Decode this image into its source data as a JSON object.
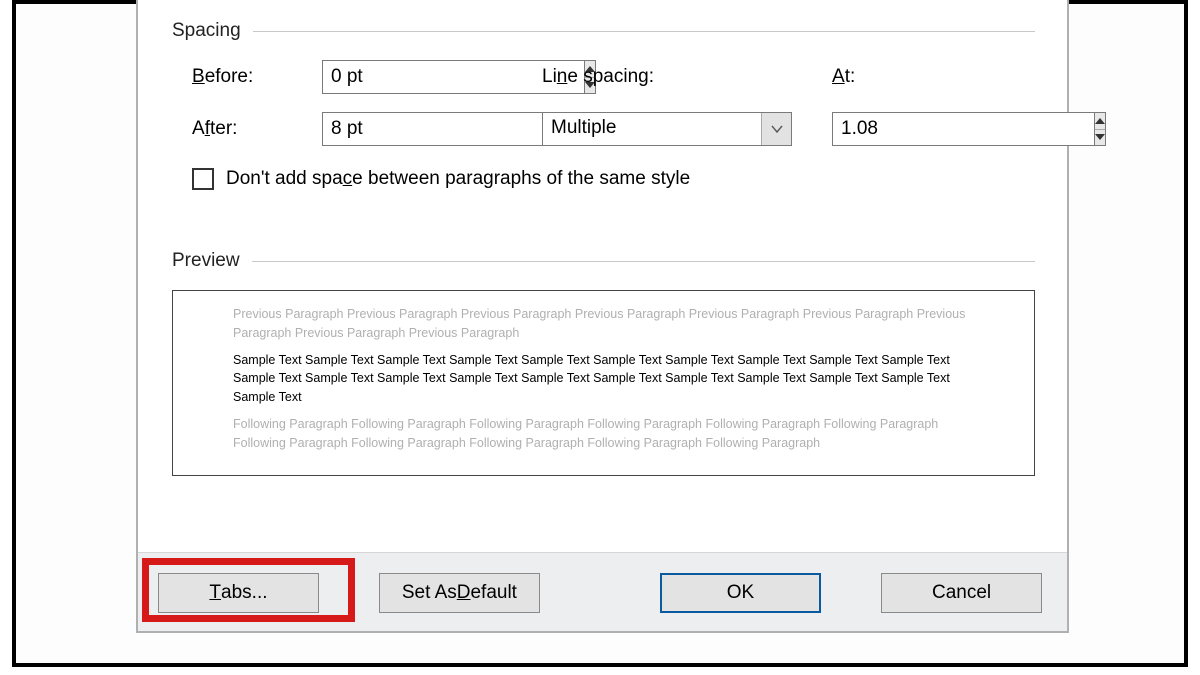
{
  "spacing": {
    "section_label": "Spacing",
    "before_label_pre": "",
    "before_label_mn": "B",
    "before_label_post": "efore:",
    "before_value": "0 pt",
    "after_label_pre": "A",
    "after_label_mn": "f",
    "after_label_post": "ter:",
    "after_value": "8 pt",
    "line_label_pre": "Li",
    "line_label_mn": "n",
    "line_label_post": "e spacing:",
    "line_value": "Multiple",
    "at_label_mn": "A",
    "at_label_post": "t:",
    "at_value": "1.08",
    "checkbox_pre": "Don't add spa",
    "checkbox_mn": "c",
    "checkbox_post": "e between paragraphs of the same style"
  },
  "preview": {
    "section_label": "Preview",
    "prev_para": "Previous Paragraph Previous Paragraph Previous Paragraph Previous Paragraph Previous Paragraph Previous Paragraph Previous Paragraph Previous Paragraph Previous Paragraph",
    "sample": "Sample Text Sample Text Sample Text Sample Text Sample Text Sample Text Sample Text Sample Text Sample Text Sample Text Sample Text Sample Text Sample Text Sample Text Sample Text Sample Text Sample Text Sample Text Sample Text Sample Text Sample Text",
    "next_para": "Following Paragraph Following Paragraph Following Paragraph Following Paragraph Following Paragraph Following Paragraph Following Paragraph Following Paragraph Following Paragraph Following Paragraph Following Paragraph"
  },
  "buttons": {
    "tabs_mn": "T",
    "tabs_post": "abs...",
    "default_pre": "Set As ",
    "default_mn": "D",
    "default_post": "efault",
    "ok": "OK",
    "cancel": "Cancel"
  }
}
